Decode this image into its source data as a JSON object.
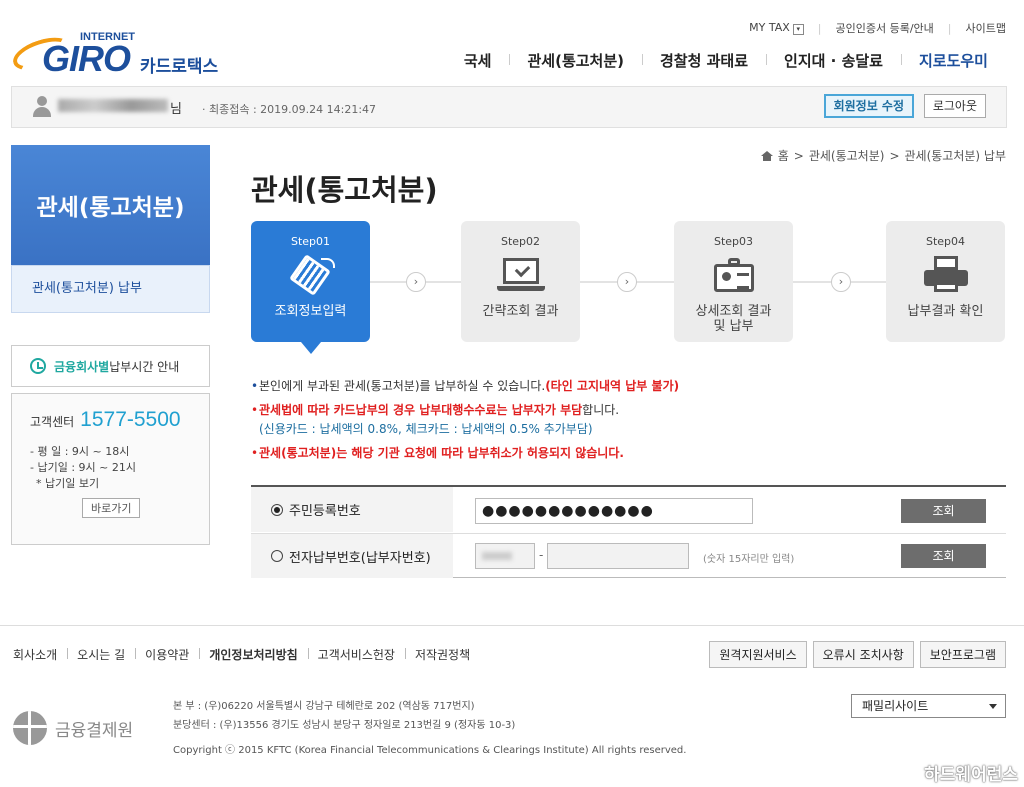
{
  "utility": {
    "mytax": "MY TAX",
    "mytax_dd": "▾",
    "cert": "공인인증서 등록/안내",
    "sitemap": "사이트맵"
  },
  "logo": {
    "top": "INTERNET",
    "main": "GIRO",
    "sub": "카드로택스"
  },
  "gnb": [
    "국세",
    "관세(통고처분)",
    "경찰청 과태료",
    "인지대 · 송달료",
    "지로도우미"
  ],
  "user": {
    "suffix": "님",
    "last_login": "· 최종접속 : 2019.09.24 14:21:47",
    "edit": "회원정보 수정",
    "logout": "로그아웃"
  },
  "sidebar": {
    "title": "관세(통고처분)",
    "sub": "관세(통고처분) 납부",
    "hours_hl": "금융회사별",
    "hours_rest": " 납부시간 안내",
    "center_label": "고객센터",
    "phone": "1577-5500",
    "weekday": "- 평    일 : 9시 ~ 18시",
    "due": "- 납기일 : 9시 ~ 21시",
    "due_link": "* 납기일 보기",
    "go": "바로가기"
  },
  "breadcrumb": {
    "home": "홈",
    "sep": ">",
    "l1": "관세(통고처분)",
    "l2": "관세(통고처분) 납부"
  },
  "page_title": "관세(통고처분)",
  "steps": [
    {
      "num": "Step01",
      "label": "조회정보입력",
      "icon": "keyboard-icon"
    },
    {
      "num": "Step02",
      "label": "간략조회 결과",
      "icon": "laptop-check-icon"
    },
    {
      "num": "Step03",
      "label": "상세조회 결과 및 납부",
      "icon": "id-card-icon"
    },
    {
      "num": "Step04",
      "label": "납부결과 확인",
      "icon": "printer-icon"
    }
  ],
  "step_arrow": "›",
  "notices": {
    "n1": "본인에게 부과된 관세(통고처분)를 납부하실 수 있습니다.",
    "n1_red": "(타인 고지내역 납부 불가)",
    "n2_red": "관세법에 따라 카드납부의 경우 납부대행수수료는 납부자가 부담",
    "n2": "합니다.",
    "n2_sub": "(신용카드 : 납세액의 0.8%, 체크카드 : 납세액의 0.5% 추가부담)",
    "n3_red": "관세(통고처분)는 해당 기관 요청에 따라 납부취소가 허용되지 않습니다."
  },
  "form": {
    "r1_label": "주민등록번호",
    "r1_value": "●●●●●●●●●●●●●",
    "r2_label": "전자납부번호(납부자번호)",
    "r2_dash": "-",
    "r2_hint": "(숫자 15자리만 입력)",
    "btn": "조회"
  },
  "footer": {
    "links": [
      "회사소개",
      "오시는 길",
      "이용약관",
      "개인정보처리방침",
      "고객서비스헌장",
      "저작권정책"
    ],
    "buttons": [
      "원격지원서비스",
      "오류시 조치사항",
      "보안프로그램"
    ],
    "org": "금융결제원",
    "addr1": "본        부 : (우)06220 서울특별시 강남구 테헤란로 202 (역삼동 717번지)",
    "addr2": "분당센터 : (우)13556 경기도 성남시 분당구 정자일로 213번길 9 (정자동 10-3)",
    "copyright": "Copyright ⓒ 2015 KFTC (Korea Financial Telecommunications & Clearings Institute) All rights reserved.",
    "family": "패밀리사이트"
  },
  "watermark": "하드웨어런스"
}
